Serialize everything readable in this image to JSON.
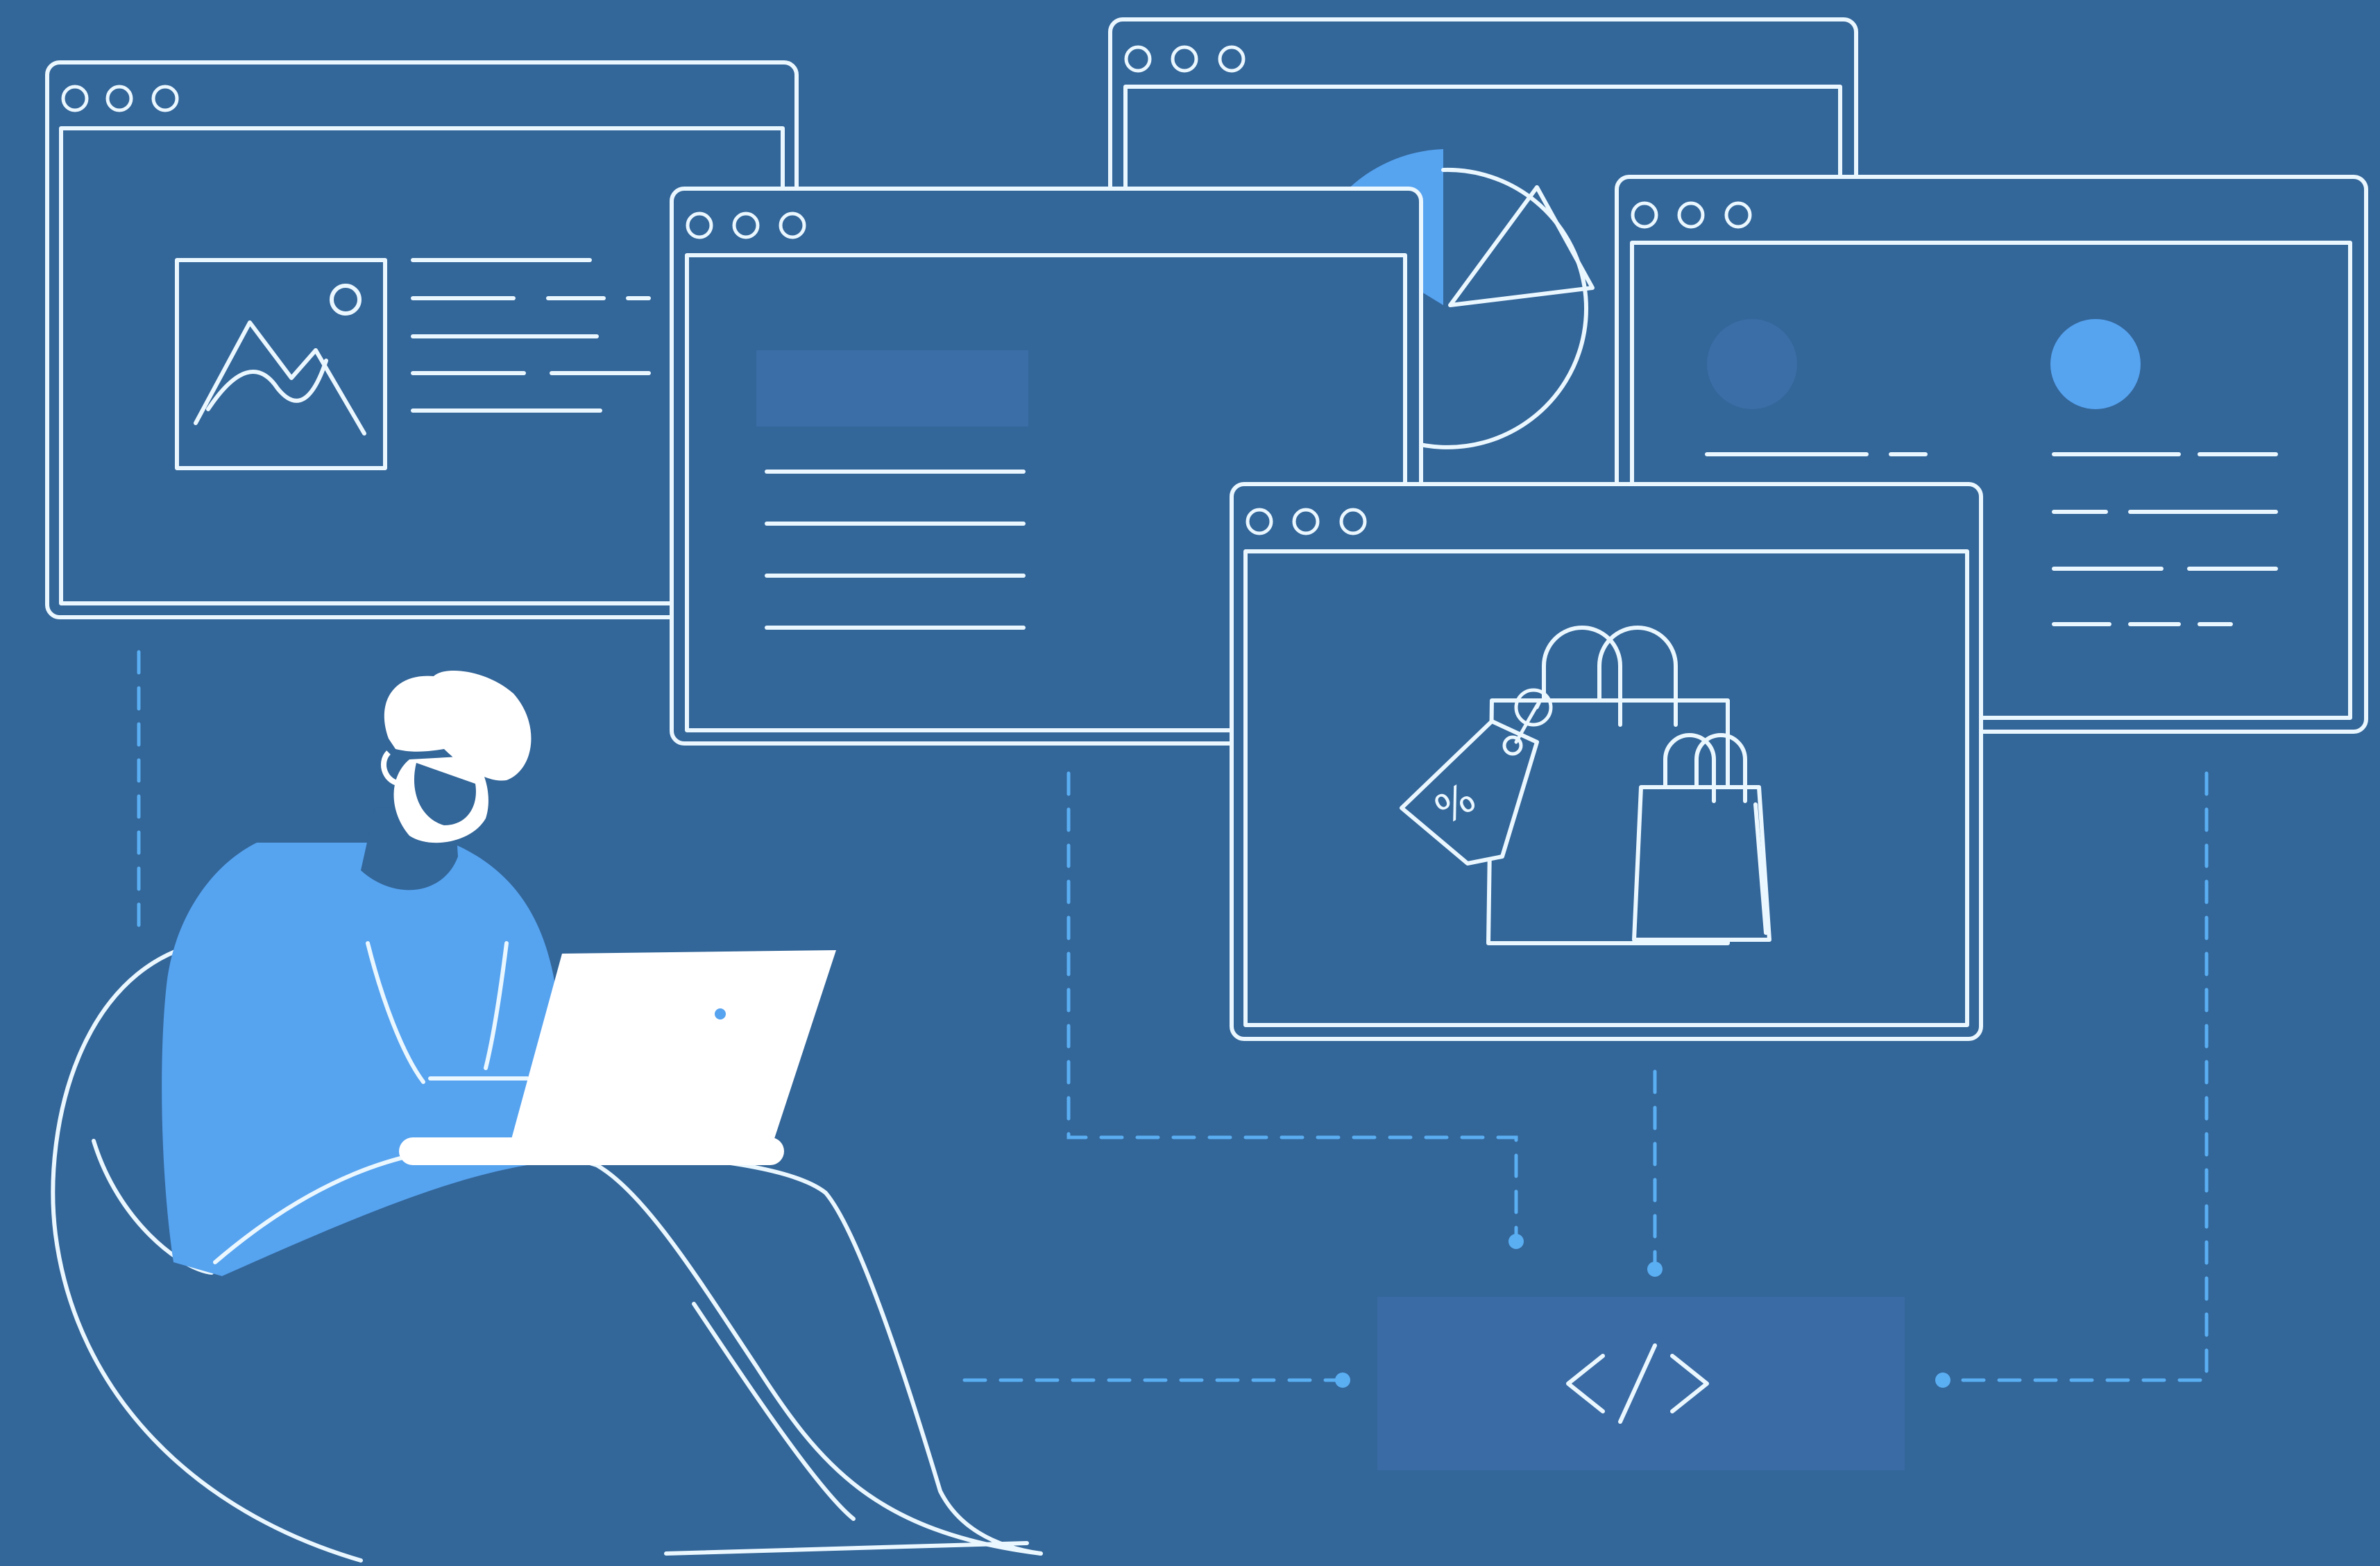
{
  "scene": {
    "description_free": true,
    "colors": {
      "background": "#336699",
      "outline": "#EAF7FF",
      "accent": "#56A3F0",
      "accent_dim": "#3B6EA6",
      "connector": "#5AAEF2",
      "code_box": "#3A6BA5"
    },
    "icons": {
      "window_controls": "window-controls-icon",
      "image": "image-icon",
      "pie_chart": "pie-chart-icon",
      "shopping_bags": "shopping-bags-icon",
      "price_tag": "price-tag-icon",
      "percent": "percent-icon",
      "code": "code-icon",
      "avatar": "avatar-icon",
      "laptop": "laptop-icon",
      "person": "person-icon"
    },
    "code_symbol": "</>",
    "tag_symbol": "%"
  }
}
